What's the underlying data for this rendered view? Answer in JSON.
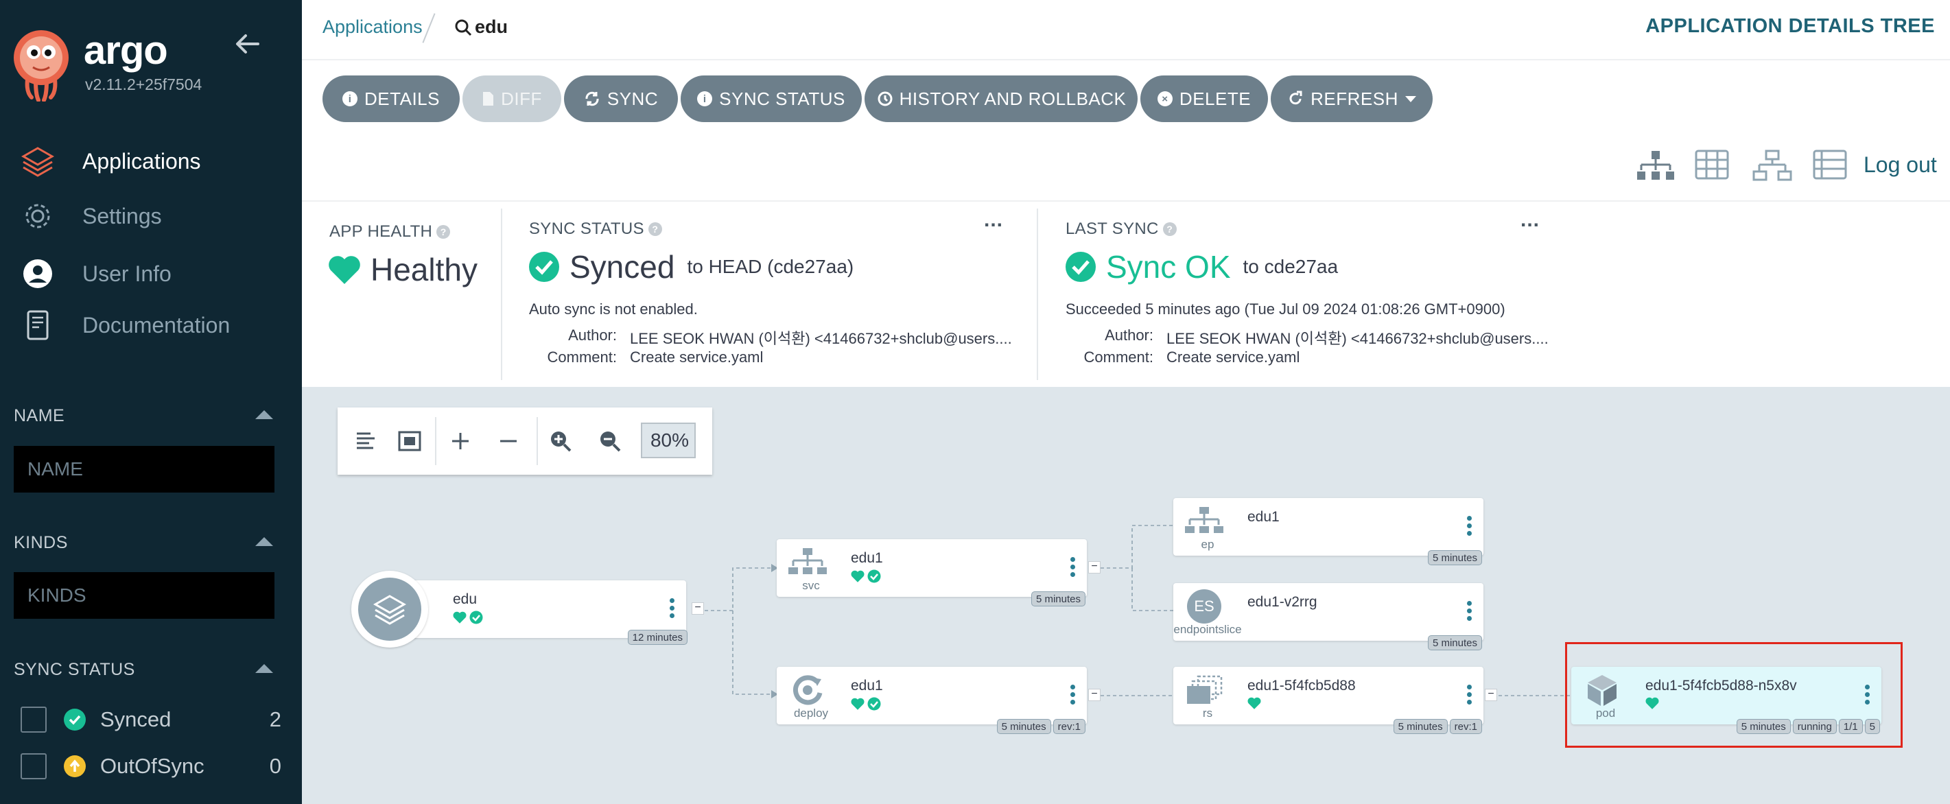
{
  "app": {
    "name": "argo",
    "version": "v2.11.2+25f7504"
  },
  "sidebar": {
    "nav": [
      {
        "label": "Applications",
        "icon": "layers-icon"
      },
      {
        "label": "Settings",
        "icon": "gear-icon"
      },
      {
        "label": "User Info",
        "icon": "user-icon"
      },
      {
        "label": "Documentation",
        "icon": "book-icon"
      }
    ],
    "filters": {
      "name_header": "NAME",
      "name_placeholder": "NAME",
      "kinds_header": "KINDS",
      "kinds_placeholder": "KINDS",
      "sync_header": "SYNC STATUS",
      "sync_options": [
        {
          "label": "Synced",
          "count": "2",
          "color": "#18be94"
        },
        {
          "label": "OutOfSync",
          "count": "0",
          "color": "#f4c030"
        }
      ]
    }
  },
  "breadcrumb": {
    "root": "Applications",
    "current": "edu"
  },
  "view_title": "APPLICATION DETAILS TREE",
  "toolbar": {
    "buttons": [
      {
        "label": "DETAILS",
        "icon": "info-icon"
      },
      {
        "label": "DIFF",
        "icon": "file-diff-icon",
        "disabled": true
      },
      {
        "label": "SYNC",
        "icon": "sync-icon"
      },
      {
        "label": "SYNC STATUS",
        "icon": "info-icon"
      },
      {
        "label": "HISTORY AND ROLLBACK",
        "icon": "history-icon"
      },
      {
        "label": "DELETE",
        "icon": "times-circle-icon"
      },
      {
        "label": "REFRESH",
        "icon": "redo-icon"
      }
    ],
    "logout": "Log out"
  },
  "status_panel": {
    "app_health": {
      "label": "APP HEALTH",
      "value": "Healthy"
    },
    "sync_status": {
      "label": "SYNC STATUS",
      "value": "Synced",
      "target": "to HEAD (cde27aa)",
      "note": "Auto sync is not enabled.",
      "author_key": "Author:",
      "author": "LEE SEOK HWAN (이석환) <41466732+shclub@users....",
      "comment_key": "Comment:",
      "comment": "Create service.yaml"
    },
    "last_sync": {
      "label": "LAST SYNC",
      "value": "Sync OK",
      "target": "to cde27aa",
      "note": "Succeeded 5 minutes ago (Tue Jul 09 2024 01:08:26 GMT+0900)",
      "author_key": "Author:",
      "author": "LEE SEOK HWAN (이석환) <41466732+shclub@users....",
      "comment_key": "Comment:",
      "comment": "Create service.yaml"
    },
    "more": "..."
  },
  "graph": {
    "zoom": "80%",
    "nodes": {
      "app": {
        "name": "edu",
        "age": "12 minutes"
      },
      "svc": {
        "name": "edu1",
        "kind": "svc",
        "age": "5 minutes"
      },
      "deploy": {
        "name": "edu1",
        "kind": "deploy",
        "age": "5 minutes",
        "rev": "rev:1"
      },
      "ep": {
        "name": "edu1",
        "kind": "ep",
        "age": "5 minutes"
      },
      "es": {
        "name": "edu1-v2rrg",
        "kind": "endpointslice",
        "badge": "ES",
        "age": "5 minutes"
      },
      "rs": {
        "name": "edu1-5f4fcb5d88",
        "kind": "rs",
        "age": "5 minutes",
        "rev": "rev:1"
      },
      "pod": {
        "name": "edu1-5f4fcb5d88-n5x8v",
        "kind": "pod",
        "age": "5 minutes",
        "state": "running",
        "ready": "1/1",
        "restarts": "5"
      }
    },
    "highlight_color": "#e0261b"
  },
  "colors": {
    "healthy": "#18be94",
    "sidebar_bg": "#0f2733",
    "accent": "#2a7f94",
    "button": "#6d7f8b"
  }
}
